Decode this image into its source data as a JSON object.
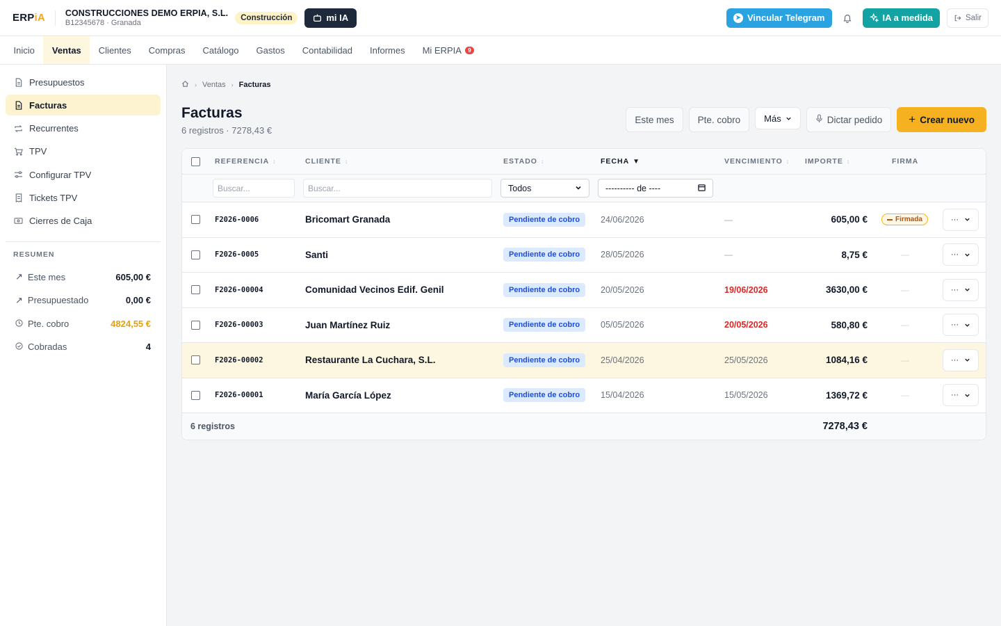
{
  "header": {
    "logo_main": "ERP",
    "logo_accent": "iA",
    "company_name": "CONSTRUCCIONES DEMO ERPIA, S.L.",
    "company_sub": "B12345678 · Granada",
    "sector_badge": "Construcción",
    "mia_label": "mi IA",
    "telegram_label": "Vincular Telegram",
    "ia_label": "IA a medida",
    "logout_label": "Salir",
    "colors": {
      "telegram": "#2aa3e0",
      "ia": "#14a3a3",
      "primary": "#f5b120",
      "dark": "#1e293b"
    }
  },
  "nav": {
    "items": [
      {
        "label": "Inicio"
      },
      {
        "label": "Ventas"
      },
      {
        "label": "Clientes"
      },
      {
        "label": "Compras"
      },
      {
        "label": "Catálogo"
      },
      {
        "label": "Gastos"
      },
      {
        "label": "Contabilidad"
      },
      {
        "label": "Informes"
      },
      {
        "label": "Mi ERPIA",
        "badge": "9"
      }
    ],
    "active": "Ventas"
  },
  "sidebar": {
    "items": [
      {
        "label": "Presupuestos",
        "icon": "document-icon"
      },
      {
        "label": "Facturas",
        "icon": "invoice-icon"
      },
      {
        "label": "Recurrentes",
        "icon": "repeat-icon"
      },
      {
        "label": "TPV",
        "icon": "cart-icon"
      },
      {
        "label": "Configurar TPV",
        "icon": "sliders-icon"
      },
      {
        "label": "Tickets TPV",
        "icon": "receipt-icon"
      },
      {
        "label": "Cierres de Caja",
        "icon": "cash-icon"
      }
    ],
    "summary_title": "RESUMEN",
    "summary": [
      {
        "label": "Este mes",
        "value": "605,00 €",
        "icon": "trend-icon"
      },
      {
        "label": "Presupuestado",
        "value": "0,00 €",
        "icon": "trend-icon"
      },
      {
        "label": "Pte. cobro",
        "value": "4824,55 €",
        "icon": "clock-icon"
      },
      {
        "label": "Cobradas",
        "value": "4",
        "icon": "check-circle-icon"
      }
    ]
  },
  "page": {
    "breadcrumb": [
      "Ventas",
      "Facturas"
    ],
    "title": "Facturas",
    "subtitle": "6 registros · 7278,43 €",
    "actions": {
      "this_month": "Este mes",
      "pending": "Pte. cobro",
      "more": "Más",
      "dictate": "Dictar pedido",
      "create": "Crear nuevo"
    }
  },
  "table": {
    "columns": {
      "ref": "REFERENCIA",
      "client": "CLIENTE",
      "status": "ESTADO",
      "date": "FECHA",
      "due": "VENCIMIENTO",
      "amount": "IMPORTE",
      "signature": "FIRMA"
    },
    "filters": {
      "ref_placeholder": "Buscar...",
      "client_placeholder": "Buscar...",
      "status_value": "Todos",
      "date_value": "---------- de ----"
    },
    "rows": [
      {
        "ref": "F2026-0006",
        "client": "Bricomart Granada",
        "status": "Pendiente de cobro",
        "date": "24/06/2026",
        "due": "—",
        "amount": "605,00 €",
        "signature": "Firmada"
      },
      {
        "ref": "F2026-0005",
        "client": "Santi",
        "status": "Pendiente de cobro",
        "date": "28/05/2026",
        "due": "—",
        "amount": "8,75 €",
        "signature": "—"
      },
      {
        "ref": "F2026-00004",
        "client": "Comunidad Vecinos Edif. Genil",
        "status": "Pendiente de cobro",
        "date": "20/05/2026",
        "due": "19/06/2026",
        "amount": "3630,00 €",
        "signature": "—"
      },
      {
        "ref": "F2026-00003",
        "client": "Juan Martínez Ruiz",
        "status": "Pendiente de cobro",
        "date": "05/05/2026",
        "due": "20/05/2026",
        "amount": "580,80 €",
        "signature": "—"
      },
      {
        "ref": "F2026-00002",
        "client": "Restaurante La Cuchara, S.L.",
        "status": "Pendiente de cobro",
        "date": "25/04/2026",
        "due": "25/05/2026",
        "amount": "1084,16 €",
        "signature": "—"
      },
      {
        "ref": "F2026-00001",
        "client": "María García López",
        "status": "Pendiente de cobro",
        "date": "15/04/2026",
        "due": "15/05/2026",
        "amount": "1369,72 €",
        "signature": "—"
      }
    ],
    "footer": {
      "count": "6 registros",
      "total": "7278,43 €"
    }
  }
}
